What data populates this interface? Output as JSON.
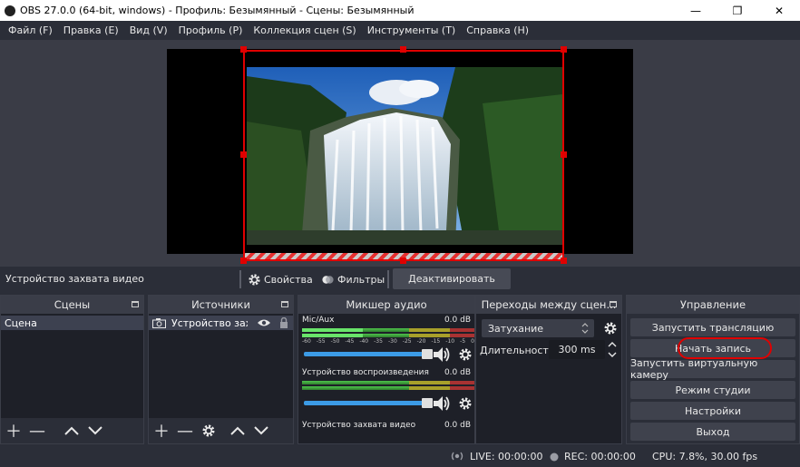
{
  "window": {
    "title": "OBS 27.0.0 (64-bit, windows) - Профиль: Безымянный - Сцены: Безымянный",
    "min_glyph": "—",
    "max_glyph": "❐",
    "close_glyph": "✕"
  },
  "menu": [
    {
      "label": "Файл (F)"
    },
    {
      "label": "Правка (E)"
    },
    {
      "label": "Вид (V)"
    },
    {
      "label": "Профиль (P)"
    },
    {
      "label": "Коллекция сцен (S)"
    },
    {
      "label": "Инструменты (T)"
    },
    {
      "label": "Справка (H)"
    }
  ],
  "source_toolbar": {
    "source_name": "Устройство захвата видео",
    "properties_label": "Свойства",
    "filters_label": "Фильтры",
    "deactivate_label": "Деактивировать"
  },
  "scenes": {
    "title": "Сцены",
    "items": [
      {
        "label": "Сцена"
      }
    ]
  },
  "sources": {
    "title": "Источники",
    "items": [
      {
        "label": "Устройство захвата видео"
      }
    ]
  },
  "mixer": {
    "title": "Микшер аудио",
    "channels": [
      {
        "name": "Mic/Aux",
        "db": "0.0 dB",
        "level": 0.35
      },
      {
        "name": "Устройство воспроизведения",
        "db": "0.0 dB",
        "level": 0.0
      },
      {
        "name": "Устройство захвата видео",
        "db": "0.0 dB",
        "level": 0.0
      }
    ],
    "scale": [
      "-60",
      "-55",
      "-50",
      "-45",
      "-40",
      "-35",
      "-30",
      "-25",
      "-20",
      "-15",
      "-10",
      "-5",
      "0"
    ]
  },
  "transitions": {
    "title": "Переходы между сцен...",
    "selected": "Затухание",
    "duration_label": "Длительность",
    "duration_value": "300 ms"
  },
  "controls": {
    "title": "Управление",
    "start_stream": "Запустить трансляцию",
    "start_record": "Начать запись",
    "start_virtualcam": "Запустить виртуальную камеру",
    "studio_mode": "Режим студии",
    "settings": "Настройки",
    "exit": "Выход"
  },
  "status": {
    "live": "LIVE: 00:00:00",
    "rec": "REC: 00:00:00",
    "cpu": "CPU: 7.8%, 30.00 fps"
  },
  "colors": {
    "accent_red": "#e00000",
    "panel_bg": "#1e2028",
    "app_bg": "#2b2e38"
  }
}
